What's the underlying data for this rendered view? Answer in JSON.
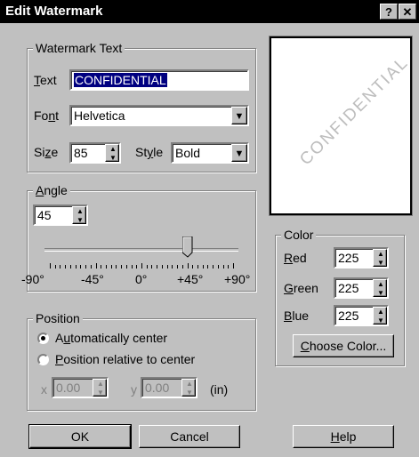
{
  "window": {
    "title": "Edit Watermark",
    "help_button": "?",
    "close_button": "✕"
  },
  "watermark_text_group": {
    "legend": "Watermark Text",
    "text_label_pre": "",
    "text_label_key": "T",
    "text_label_post": "ext",
    "text_value": "CONFIDENTIAL",
    "font_label_pre": "Fo",
    "font_label_key": "n",
    "font_label_post": "t",
    "font_value": "Helvetica",
    "size_label_pre": "Si",
    "size_label_key": "z",
    "size_label_post": "e",
    "size_value": "85",
    "style_label_pre": "St",
    "style_label_key": "y",
    "style_label_post": "le",
    "style_value": "Bold"
  },
  "angle_group": {
    "legend_key": "A",
    "legend_post": "ngle",
    "value": "45",
    "slider_value_degrees": 45,
    "ticks": [
      "-90°",
      "-45°",
      "0°",
      "+45°",
      "+90°"
    ]
  },
  "position_group": {
    "legend": "Position",
    "auto_center_pre": "A",
    "auto_center_key": "u",
    "auto_center_post": "tomatically center",
    "relative_key": "P",
    "relative_post": "osition relative to center",
    "selected": "auto_center",
    "x_label": "x",
    "x_value": "0.00",
    "y_label": "y",
    "y_value": "0.00",
    "units": "(in)"
  },
  "preview": {
    "text": "CONFIDENTIAL"
  },
  "color_group": {
    "legend": "Color",
    "red_key": "R",
    "red_post": "ed",
    "red_value": "225",
    "green_key": "G",
    "green_post": "reen",
    "green_value": "225",
    "blue_key": "B",
    "blue_post": "lue",
    "blue_value": "225",
    "choose_key": "C",
    "choose_post": "hoose Color..."
  },
  "buttons": {
    "ok": "OK",
    "cancel": "Cancel",
    "help_key": "H",
    "help_post": "elp"
  },
  "colors": {
    "titlebar": "#000000",
    "face": "#c0c0c0",
    "selection": "#000080"
  }
}
